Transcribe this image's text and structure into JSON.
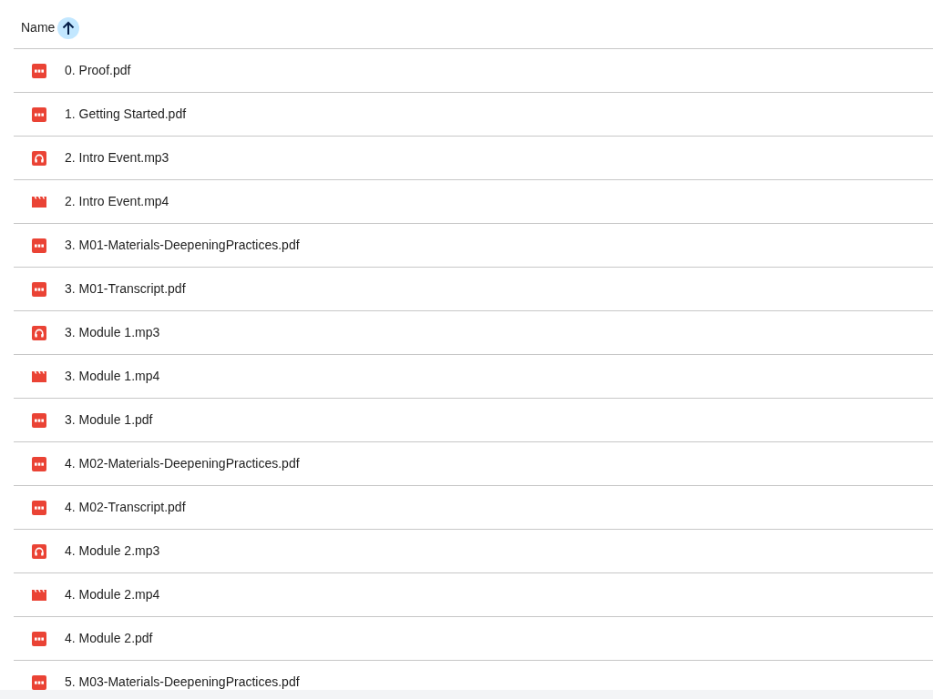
{
  "header": {
    "column": {
      "label": "Name",
      "ascending": true,
      "hovered": true
    }
  },
  "files": [
    {
      "name": "0. Proof.pdf",
      "kind": "pdf"
    },
    {
      "name": "1. Getting Started.pdf",
      "kind": "pdf"
    },
    {
      "name": "2. Intro Event.mp3",
      "kind": "audio"
    },
    {
      "name": "2. Intro Event.mp4",
      "kind": "video"
    },
    {
      "name": "3. M01-Materials-DeepeningPractices.pdf",
      "kind": "pdf"
    },
    {
      "name": "3. M01-Transcript.pdf",
      "kind": "pdf"
    },
    {
      "name": "3. Module 1.mp3",
      "kind": "audio"
    },
    {
      "name": "3. Module 1.mp4",
      "kind": "video"
    },
    {
      "name": "3. Module 1.pdf",
      "kind": "pdf"
    },
    {
      "name": "4. M02-Materials-DeepeningPractices.pdf",
      "kind": "pdf"
    },
    {
      "name": "4. M02-Transcript.pdf",
      "kind": "pdf"
    },
    {
      "name": "4. Module 2.mp3",
      "kind": "audio"
    },
    {
      "name": "4. Module 2.mp4",
      "kind": "video"
    },
    {
      "name": "4. Module 2.pdf",
      "kind": "pdf"
    },
    {
      "name": "5. M03-Materials-DeepeningPractices.pdf",
      "kind": "pdf"
    }
  ]
}
